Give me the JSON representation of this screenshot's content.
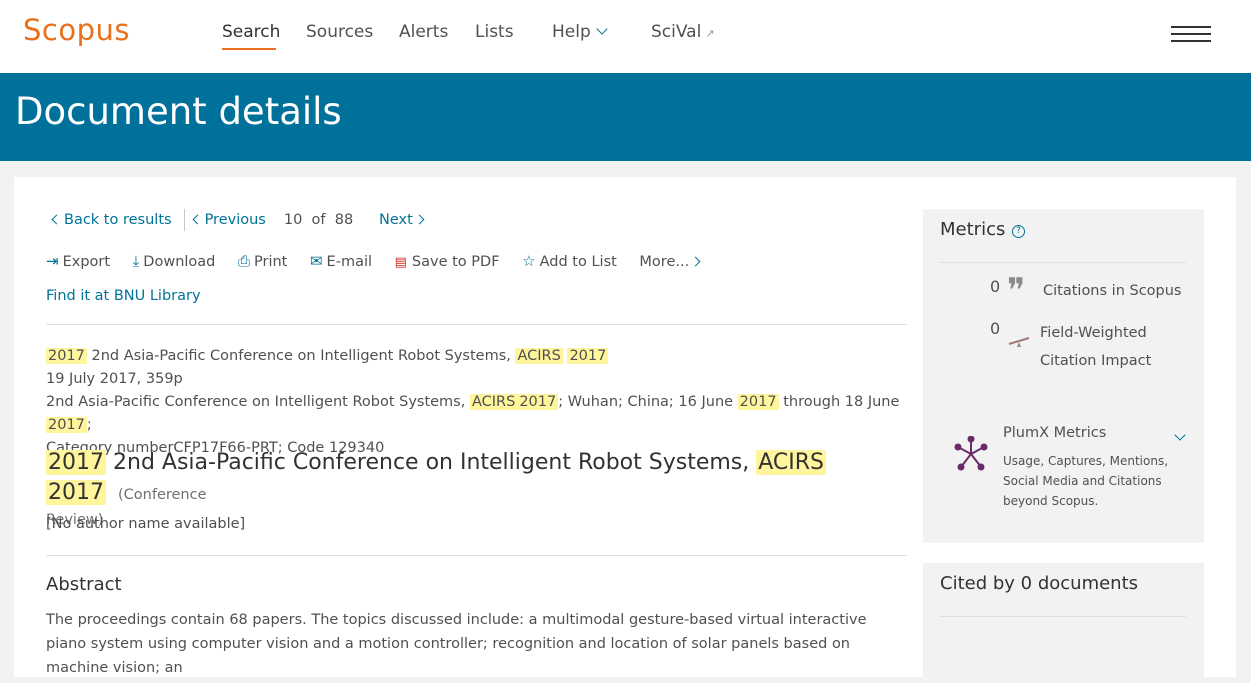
{
  "header": {
    "logo": "Scopus",
    "nav": {
      "search": "Search",
      "sources": "Sources",
      "alerts": "Alerts",
      "lists": "Lists",
      "help": "Help",
      "scival": "SciVal"
    }
  },
  "banner": {
    "title": "Document details"
  },
  "navigation": {
    "back": "Back to results",
    "previous": "Previous",
    "current": "10",
    "of": "of",
    "total": "88",
    "next": "Next"
  },
  "actions": {
    "export": "Export",
    "download": "Download",
    "print": "Print",
    "email": "E-mail",
    "save_pdf": "Save to PDF",
    "add_list": "Add to List",
    "more": "More..."
  },
  "library_link": "Find it at BNU Library",
  "source": {
    "y1": "2017",
    "name1": "2nd Asia-Pacific Conference on Intelligent Robot Systems,",
    "acirs1": "ACIRS",
    "y2": "2017",
    "date_pages": "19 July 2017, 359p",
    "name2": "2nd Asia-Pacific Conference on Intelligent Robot Systems,",
    "acirs2": "ACIRS",
    "y3": "2017",
    "location": "; Wuhan; China; 16 June",
    "y4": "2017",
    "through": "through 18 June",
    "y5": "2017",
    "semi": ";",
    "category": "Category numberCFP17F66-PRT; Code 129340"
  },
  "document": {
    "y1": "2017",
    "title_mid": "2nd Asia-Pacific Conference on Intelligent Robot Systems,",
    "acirs": "ACIRS",
    "y2": "2017",
    "type_a": "(Conference",
    "type_b": "Review)",
    "author": "[No author name available]"
  },
  "abstract": {
    "heading": "Abstract",
    "text": "The proceedings contain 68 papers. The topics discussed include: a multimodal gesture-based virtual interactive piano system using computer vision and a motion controller; recognition and location of solar panels based on machine vision; an"
  },
  "metrics": {
    "heading": "Metrics",
    "citations_count": "0",
    "citations_label": "Citations in Scopus",
    "fwci_count": "0",
    "fwci_label_1": "Field-Weighted",
    "fwci_label_2": "Citation Impact",
    "plumx_title": "PlumX Metrics",
    "plumx_desc": "Usage, Captures, Mentions, Social Media and Citations beyond Scopus."
  },
  "cited_by": {
    "heading": "Cited by 0 documents"
  },
  "colors": {
    "accent": "#e9711c",
    "banner": "#00719a",
    "link": "#007398",
    "highlight": "#fff59d"
  }
}
